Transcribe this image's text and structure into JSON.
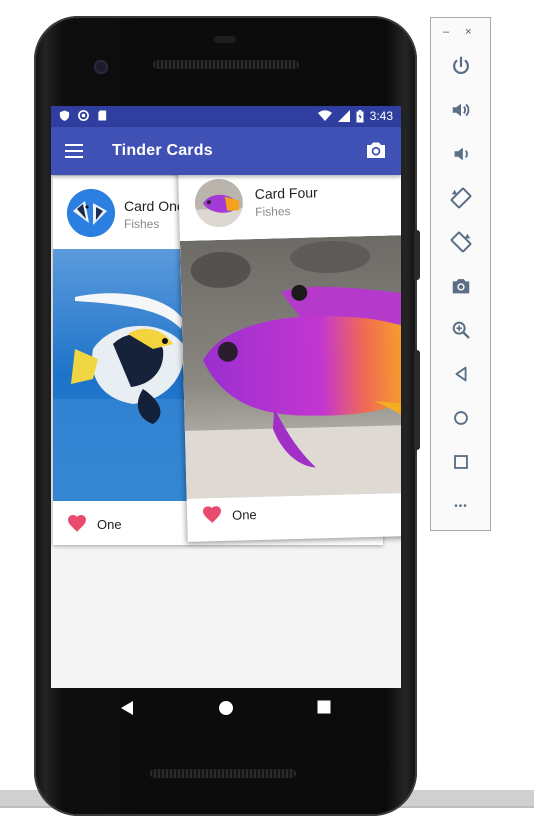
{
  "status_bar": {
    "time": "3:43"
  },
  "app_bar": {
    "title": "Tinder Cards"
  },
  "cards": [
    {
      "title": "Card One",
      "subtitle": "Fishes",
      "like_label": "One"
    },
    {
      "title": "Card Four",
      "subtitle": "Fishes",
      "like_label": "One"
    }
  ],
  "emulator_panel": {
    "minimize_label": "–",
    "close_label": "×",
    "more_label": "•••"
  },
  "colors": {
    "primary": "#3f51b5",
    "primary_dark": "#303f9f",
    "heart": "#e94b6e"
  },
  "icons": [
    "menu-icon",
    "camera-icon",
    "heart-icon",
    "power-icon",
    "volume-up-icon",
    "volume-down-icon",
    "rotate-left-icon",
    "rotate-right-icon",
    "screenshot-icon",
    "zoom-icon",
    "back-icon",
    "home-icon",
    "overview-icon",
    "more-icon"
  ]
}
